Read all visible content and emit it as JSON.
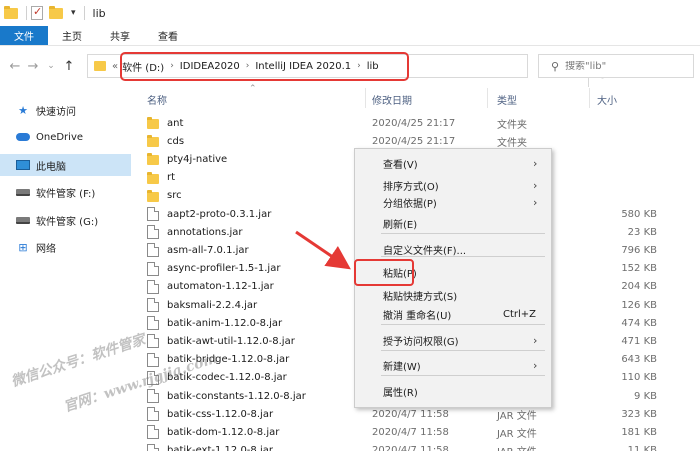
{
  "title_bar": {
    "window_title": "lib",
    "qa_dropdown": "▾"
  },
  "ribbon": {
    "tabs": [
      "文件",
      "主页",
      "共享",
      "查看"
    ]
  },
  "address_bar": {
    "overflow": "«",
    "crumbs": [
      "软件 (D:)",
      "IDIDEA2020",
      "IntelliJ IDEA 2020.1",
      "lib"
    ],
    "separator": "›",
    "dropdown": "⌄",
    "refresh": "↻"
  },
  "search": {
    "placeholder": "搜索\"lib\"",
    "icon": "search-icon"
  },
  "nav_pane": {
    "items": [
      {
        "label": "快速访问",
        "icon": "star-icon"
      },
      {
        "label": "OneDrive",
        "icon": "cloud-icon"
      },
      {
        "label": "此电脑",
        "icon": "pc-icon",
        "selected": true
      },
      {
        "label": "软件管家 (F:)",
        "icon": "drive-icon"
      },
      {
        "label": "软件管家 (G:)",
        "icon": "drive-icon"
      },
      {
        "label": "网络",
        "icon": "network-icon"
      }
    ]
  },
  "file_list": {
    "columns": {
      "name": "名称",
      "date": "修改日期",
      "type": "类型",
      "size": "大小"
    },
    "rows": [
      {
        "name": "ant",
        "kind": "folder",
        "date": "2020/4/25 21:17",
        "type": "文件夹",
        "size": ""
      },
      {
        "name": "cds",
        "kind": "folder",
        "date": "2020/4/25 21:17",
        "type": "文件夹",
        "size": ""
      },
      {
        "name": "pty4j-native",
        "kind": "folder",
        "date": "",
        "type": "",
        "size": ""
      },
      {
        "name": "rt",
        "kind": "folder",
        "date": "",
        "type": "",
        "size": ""
      },
      {
        "name": "src",
        "kind": "folder",
        "date": "",
        "type": "",
        "size": ""
      },
      {
        "name": "aapt2-proto-0.3.1.jar",
        "kind": "file",
        "date": "",
        "type": "",
        "size": "580 KB"
      },
      {
        "name": "annotations.jar",
        "kind": "file",
        "date": "",
        "type": "",
        "size": "23 KB"
      },
      {
        "name": "asm-all-7.0.1.jar",
        "kind": "file",
        "date": "",
        "type": "",
        "size": "796 KB"
      },
      {
        "name": "async-profiler-1.5-1.jar",
        "kind": "file",
        "date": "",
        "type": "",
        "size": "152 KB"
      },
      {
        "name": "automaton-1.12-1.jar",
        "kind": "file",
        "date": "",
        "type": "",
        "size": "204 KB"
      },
      {
        "name": "baksmali-2.2.4.jar",
        "kind": "file",
        "date": "",
        "type": "",
        "size": "126 KB"
      },
      {
        "name": "batik-anim-1.12.0-8.jar",
        "kind": "file",
        "date": "",
        "type": "",
        "size": "474 KB"
      },
      {
        "name": "batik-awt-util-1.12.0-8.jar",
        "kind": "file",
        "date": "",
        "type": "",
        "size": "471 KB"
      },
      {
        "name": "batik-bridge-1.12.0-8.jar",
        "kind": "file",
        "date": "",
        "type": "",
        "size": "643 KB"
      },
      {
        "name": "batik-codec-1.12.0-8.jar",
        "kind": "file",
        "date": "",
        "type": "",
        "size": "110 KB"
      },
      {
        "name": "batik-constants-1.12.0-8.jar",
        "kind": "file",
        "date": "",
        "type": "",
        "size": "9 KB"
      },
      {
        "name": "batik-css-1.12.0-8.jar",
        "kind": "file",
        "date": "2020/4/7 11:58",
        "type": "JAR 文件",
        "size": "323 KB"
      },
      {
        "name": "batik-dom-1.12.0-8.jar",
        "kind": "file",
        "date": "2020/4/7 11:58",
        "type": "JAR 文件",
        "size": "181 KB"
      },
      {
        "name": "batik-ext-1.12.0-8.jar",
        "kind": "file",
        "date": "2020/4/7 11:58",
        "type": "JAR 文件",
        "size": "11 KB"
      }
    ]
  },
  "context_menu": {
    "items": [
      {
        "label": "查看(V)",
        "submenu": true
      },
      {
        "label": "排序方式(O)",
        "submenu": true
      },
      {
        "label": "分组依据(P)",
        "submenu": true
      },
      {
        "label": "刷新(E)"
      },
      {
        "label": "自定义文件夹(F)..."
      },
      {
        "label": "粘贴(P)",
        "highlighted": true
      },
      {
        "label": "粘贴快捷方式(S)"
      },
      {
        "label": "撤消 重命名(U)",
        "shortcut": "Ctrl+Z"
      },
      {
        "label": "授予访问权限(G)",
        "submenu": true
      },
      {
        "label": "新建(W)",
        "submenu": true
      },
      {
        "label": "属性(R)"
      }
    ]
  },
  "watermark": [
    "微信公众号：软件管家",
    "官网：www.rjgjia.com"
  ],
  "colors": {
    "accent": "#1979ca",
    "annotation": "#e53935",
    "selection": "#cce4f7"
  }
}
